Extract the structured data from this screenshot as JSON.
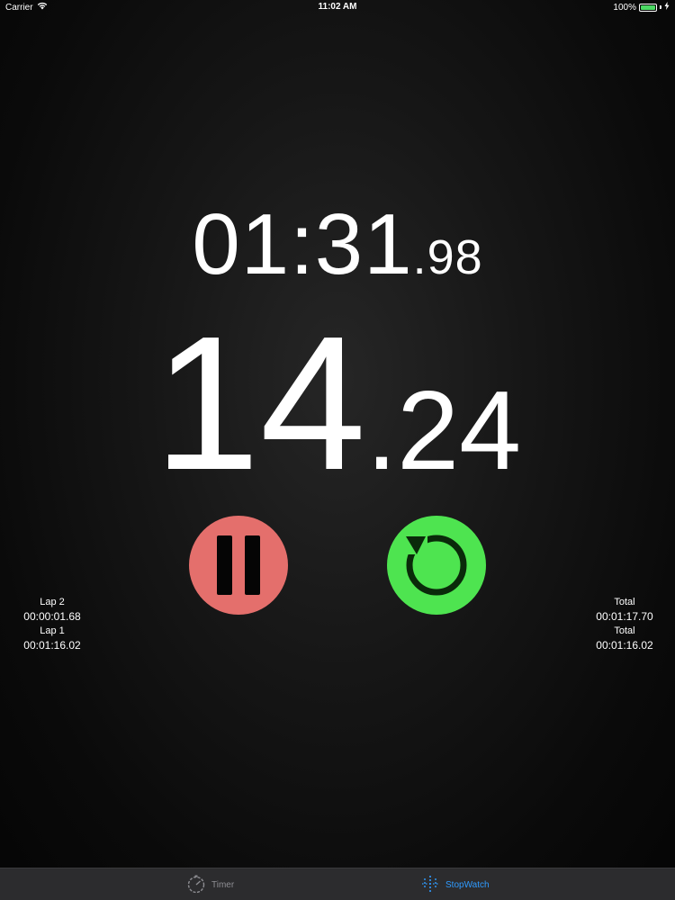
{
  "status_bar": {
    "carrier": "Carrier",
    "time": "11:02 AM",
    "battery_percent": "100%",
    "battery_level": 1.0,
    "wifi_icon": "wifi-icon",
    "charging_icon": "charging-icon"
  },
  "stopwatch": {
    "main_time": "01:31",
    "main_time_hundredths": ".98",
    "lap_time": "14",
    "lap_time_hundredths": ".24"
  },
  "buttons": {
    "pause_icon": "pause-icon",
    "pause_color": "#e46f6c",
    "lap_icon": "lap-reset-icon",
    "lap_color": "#4ee450"
  },
  "laps": [
    {
      "label": "Lap 2",
      "value": "00:00:01.68",
      "total_label": "Total",
      "total": "00:01:17.70"
    },
    {
      "label": "Lap 1",
      "value": "00:01:16.02",
      "total_label": "Total",
      "total": "00:01:16.02"
    }
  ],
  "tab_bar": {
    "tabs": [
      {
        "label": "Timer",
        "icon": "timer-icon",
        "active": false
      },
      {
        "label": "StopWatch",
        "icon": "stopwatch-icon",
        "active": true
      }
    ],
    "active_color": "#2f9bff",
    "inactive_color": "#8e8e93"
  }
}
